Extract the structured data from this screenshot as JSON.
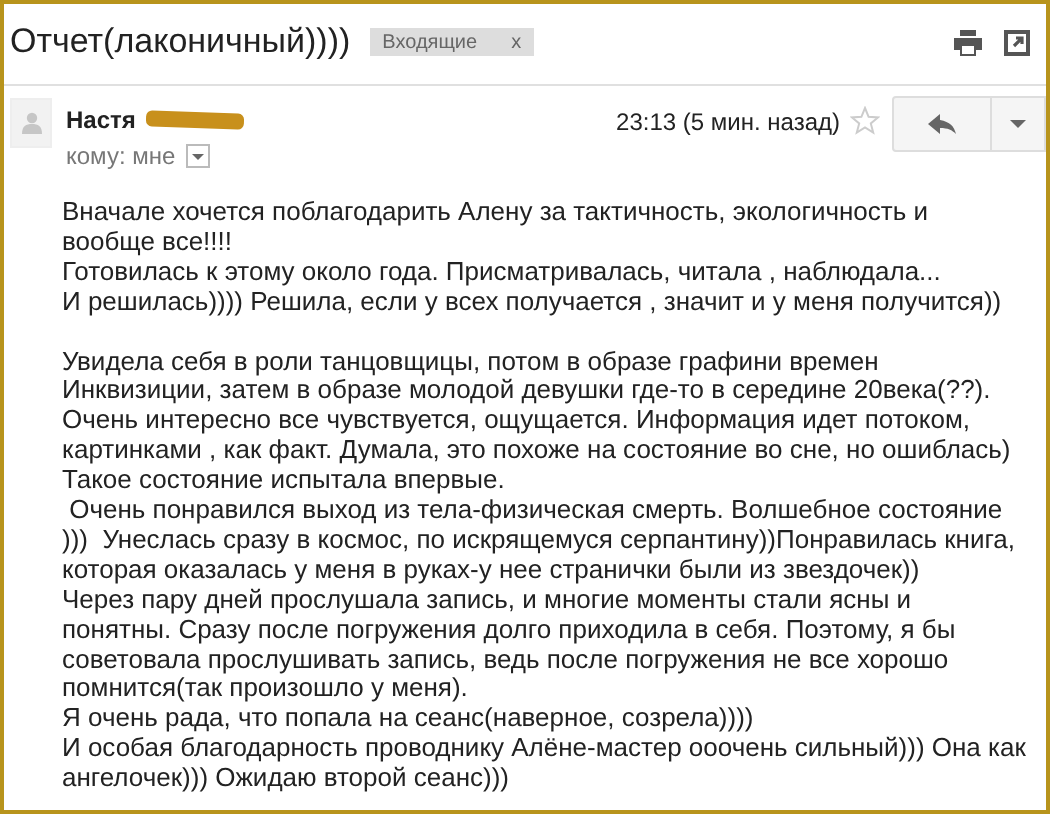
{
  "subject": "Отчет(лаконичный))))",
  "labels": [
    {
      "text": "Входящие",
      "remove": "x"
    }
  ],
  "sender": {
    "name": "Настя",
    "redacted": true
  },
  "recipient": "кому: мне",
  "time": "23:13 (5 мин. назад)",
  "starred": false,
  "paragraphs": [
    [
      "Вначале хочется поблагодарить Алену за тактичность, экологичность и",
      "вообще все!!!!",
      "Готовилась к этому около года. Присматривалась, читала , наблюдала...",
      "И решилась)))) Решила, если у всех получается , значит и у меня получится))"
    ],
    [
      "Увидела себя в роли танцовщицы, потом в образе графини времен",
      "Инквизиции, затем в образе молодой девушки где-то в середине 20века(??).",
      "Очень интересно все чувствуется, ощущается. Информация идет потоком,",
      "картинками , как факт. Думала, это похоже на состояние во сне, но ошиблась)",
      "Такое состояние испытала впервые.",
      " Очень понравился выход из тела-физическая смерть. Волшебное состояние",
      ")))  Унеслась сразу в космос, по искрящемуся серпантину))Понравилась книга,",
      "которая оказалась у меня в руках-у нее странички были из звездочек))",
      "Через пару дней прослушала запись, и многие моменты стали ясны и",
      "понятны. Сразу после погружения долго приходила в себя. Поэтому, я бы",
      "советовала прослушивать запись, ведь после погружения не все хорошо",
      "помнится(так произошло у меня).",
      "Я очень рада, что попала на сеанс(наверное, созрела))))",
      "И особая благодарность проводнику Алёне-мастер ооочень сильный))) Она как",
      "ангелочек))) Ожидаю второй сеанс)))"
    ]
  ]
}
